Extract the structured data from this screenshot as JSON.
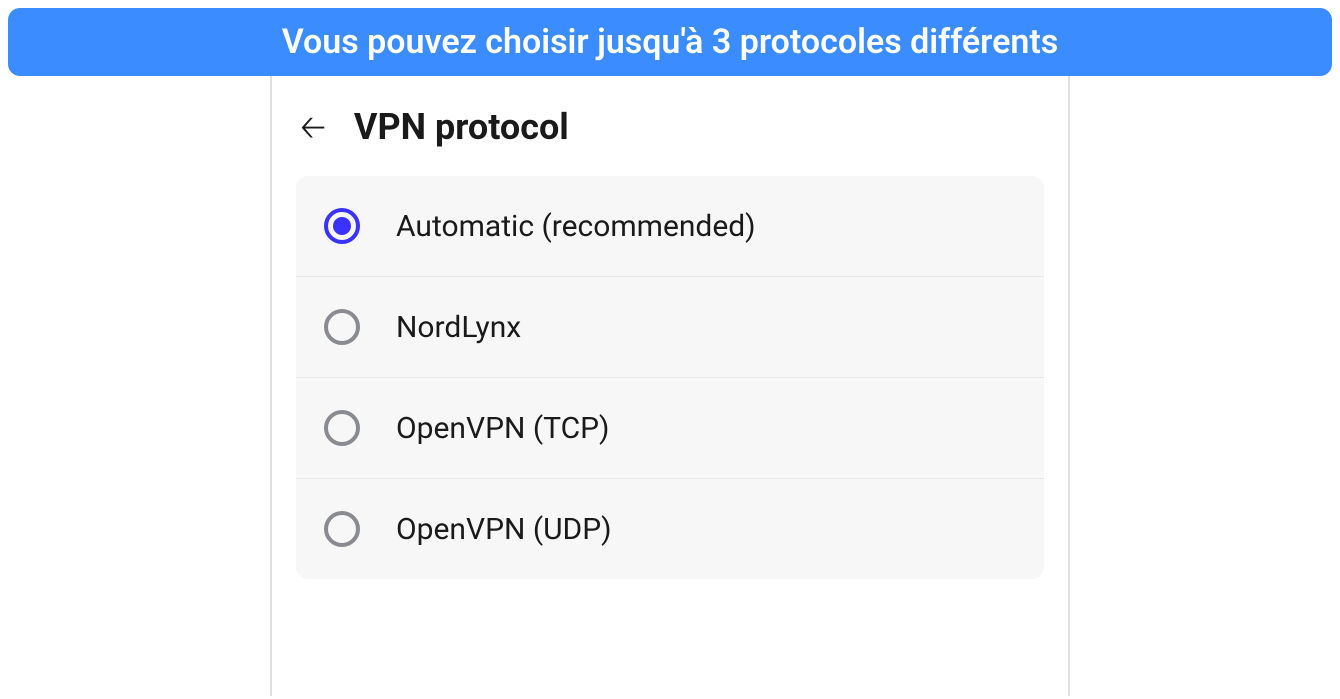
{
  "banner": {
    "text": "Vous pouvez choisir jusqu'à 3 protocoles différents"
  },
  "header": {
    "title": "VPN protocol"
  },
  "options": [
    {
      "label": "Automatic (recommended)",
      "selected": true
    },
    {
      "label": "NordLynx",
      "selected": false
    },
    {
      "label": "OpenVPN (TCP)",
      "selected": false
    },
    {
      "label": "OpenVPN (UDP)",
      "selected": false
    }
  ],
  "colors": {
    "banner_bg": "#3a8cff",
    "radio_selected": "#3a33ff",
    "radio_unselected": "#8a8a92",
    "panel_bg": "#f7f7f8"
  }
}
